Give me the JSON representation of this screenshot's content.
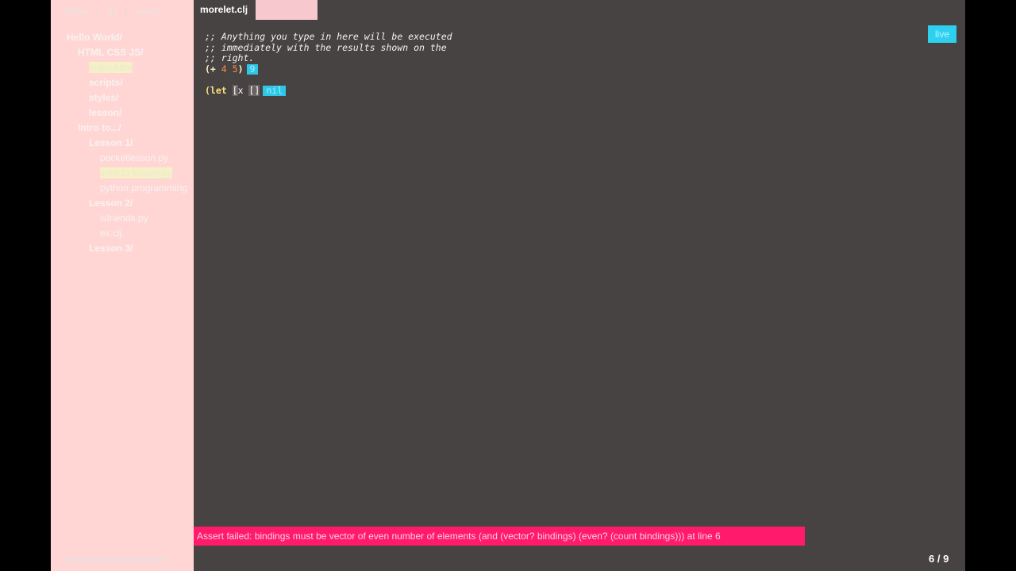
{
  "sidebar": {
    "tabs": [
      "folder",
      "all",
      "recent"
    ],
    "separator": "|",
    "tree": [
      {
        "label": "Hello World/",
        "type": "folder",
        "indent": 0
      },
      {
        "label": "HTML CSS JS/",
        "type": "folder",
        "indent": 1
      },
      {
        "label": "index.html",
        "type": "file",
        "indent": 2,
        "selected": true
      },
      {
        "label": "scripts/",
        "type": "folder",
        "indent": 2
      },
      {
        "label": "styles/",
        "type": "folder",
        "indent": 2
      },
      {
        "label": "lesson/",
        "type": "folder",
        "indent": 2
      },
      {
        "label": "Intro to.../",
        "type": "folder",
        "indent": 1
      },
      {
        "label": "Lesson 1/",
        "type": "folder",
        "indent": 2
      },
      {
        "label": "pocketlesson.py",
        "type": "file",
        "indent": 3
      },
      {
        "label": "intro to lesson.py",
        "type": "file",
        "indent": 3,
        "selected": true
      },
      {
        "label": "python programming",
        "type": "file",
        "indent": 3
      },
      {
        "label": "Lesson 2/",
        "type": "folder",
        "indent": 2
      },
      {
        "label": "isfriends.py",
        "type": "file",
        "indent": 3
      },
      {
        "label": "ex.clj",
        "type": "file",
        "indent": 3
      },
      {
        "label": "Lesson 3/",
        "type": "folder",
        "indent": 2
      }
    ]
  },
  "editor": {
    "tabs": [
      {
        "label": "morelet.clj",
        "active": true
      },
      {
        "label": "",
        "active": false
      }
    ],
    "comments": [
      ";; Anything you type in here will be executed",
      ";; immediately with the results shown on the",
      ";; right."
    ],
    "line1": {
      "open": "(+",
      "a": "4",
      "b": "5",
      "close": ")",
      "result": "9"
    },
    "line2": {
      "open": "(let",
      "b1": "[",
      "sym": "x",
      "b2": "[]",
      "result": "nil"
    },
    "live_label": "live"
  },
  "error": "Assert failed: bindings must be vector of even number of elements (and (vector? bindings) (even? (count bindings))) at line 6",
  "page_indicator": "6 / 9",
  "colors": {
    "sidebar_bg": "#ffd6d4",
    "editor_bg": "#474343",
    "accent": "#2ed0f0",
    "error_bg": "#ff1a6b"
  }
}
